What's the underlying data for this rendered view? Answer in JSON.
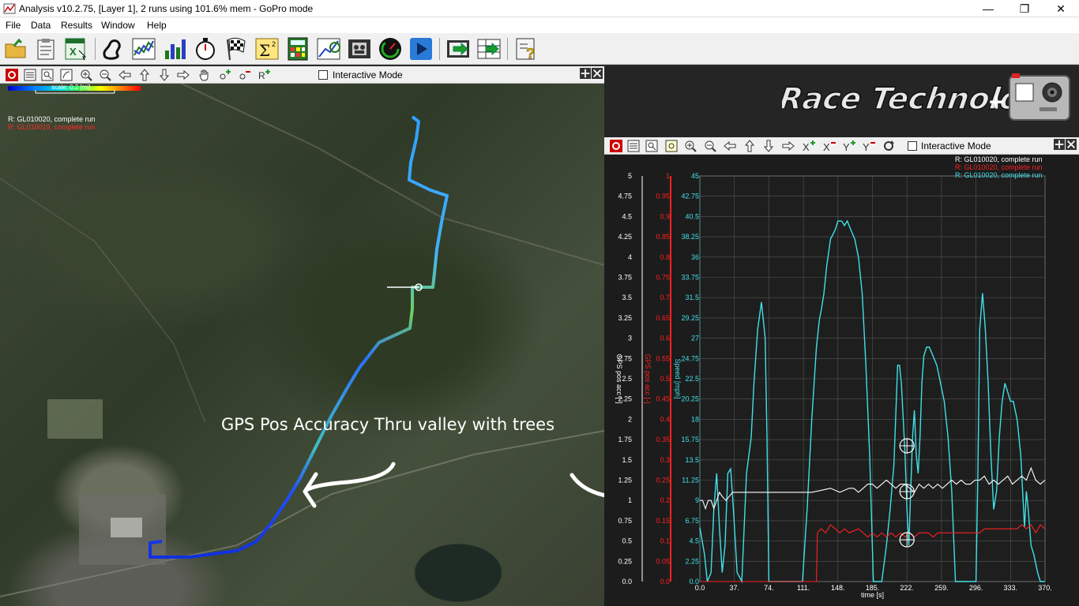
{
  "window": {
    "title": "Analysis v10.2.75, [Layer 1], 2 runs using 101.6% mem - GoPro mode",
    "controls": [
      "—",
      "❐",
      "✕"
    ]
  },
  "menu": [
    "File",
    "Data",
    "Results",
    "Window",
    "Help"
  ],
  "toolbar_icons": [
    "open-folder-icon",
    "clipboard-icon",
    "excel-icon",
    "track-map-icon",
    "line-graph-icon",
    "bar-chart-icon",
    "stopwatch-icon",
    "checkered-flag-icon",
    "sigma-icon",
    "calculator-icon",
    "xy-plot-icon",
    "video-icon",
    "gauge-icon",
    "play-icon",
    "export-video-icon",
    "export-table-icon",
    "help-icon"
  ],
  "map": {
    "interactive_mode_label": "Interactive Mode",
    "scale_label": "scale: 0.2 [mi]",
    "run_labels": [
      {
        "text": "R:  GL010020, complete run",
        "color": "#ffffff"
      },
      {
        "text": "R:  GL010019, complete run",
        "color": "#ff2a2a"
      }
    ],
    "annotation": "GPS Pos Accuracy Thru valley with trees"
  },
  "graph": {
    "interactive_mode_label": "Interactive Mode",
    "legend": [
      {
        "text": "R:  GL010020, complete run",
        "color": "#ffffff"
      },
      {
        "text": "R:  GL010020, complete run",
        "color": "#ff2020"
      },
      {
        "text": "R:  GL010020, complete run",
        "color": "#40e0e8"
      }
    ],
    "xlabel": "time [s]"
  },
  "chart_data": {
    "type": "line",
    "xlabel": "time [s]",
    "xlim": [
      0,
      370
    ],
    "x_ticks": [
      "0.0",
      "37.",
      "74.",
      "111.",
      "148.",
      "185.",
      "222.",
      "259.",
      "296.",
      "333.",
      "370."
    ],
    "axes": [
      {
        "label": "GPS pos acc [-]",
        "color": "#ffffff",
        "ylim": [
          0,
          5
        ],
        "ticks": [
          "0.0",
          "0.25",
          "0.5",
          "0.75",
          "1",
          "1.25",
          "1.5",
          "1.75",
          "2",
          "2.25",
          "2.5",
          "2.75",
          "3",
          "3.25",
          "3.5",
          "3.75",
          "4",
          "4.25",
          "4.5",
          "4.75",
          "5"
        ]
      },
      {
        "label": "GPS pos acc [-]",
        "color": "#ff2020",
        "ylim": [
          0,
          1
        ],
        "ticks": [
          "0.0",
          "0.05",
          "0.1",
          "0.15",
          "0.2",
          "0.25",
          "0.3",
          "0.35",
          "0.4",
          "0.45",
          "0.5",
          "0.55",
          "0.6",
          "0.65",
          "0.7",
          "0.75",
          "0.8",
          "0.85",
          "0.9",
          "0.95",
          "1"
        ]
      },
      {
        "label": "Speed [mph]",
        "color": "#40e0e8",
        "ylim": [
          0,
          45
        ],
        "ticks": [
          "0.0",
          "2.25",
          "4.5",
          "6.75",
          "9",
          "11.25",
          "13.5",
          "15.75",
          "18",
          "20.25",
          "22.5",
          "24.75",
          "27",
          "29.25",
          "31.5",
          "33.75",
          "36",
          "38.25",
          "40.5",
          "42.75",
          "45"
        ]
      }
    ],
    "series": [
      {
        "name": "GL010020, complete run",
        "color": "#40e0e8",
        "axis": 2,
        "x": [
          0,
          5,
          8,
          12,
          15,
          18,
          21,
          24,
          27,
          30,
          33,
          36,
          40,
          45,
          50,
          55,
          58,
          62,
          66,
          70,
          72,
          74,
          76,
          80,
          85,
          90,
          95,
          100,
          105,
          110,
          115,
          120,
          125,
          128,
          130,
          133,
          136,
          140,
          145,
          148,
          152,
          155,
          158,
          162,
          166,
          170,
          174,
          178,
          182,
          186,
          190,
          195,
          200,
          204,
          208,
          212,
          214,
          216,
          218,
          220,
          222,
          224,
          226,
          228,
          230,
          232,
          234,
          236,
          238,
          240,
          243,
          246,
          250,
          254,
          258,
          262,
          266,
          270,
          274,
          278,
          282,
          286,
          290,
          294,
          296,
          298,
          300,
          303,
          306,
          309,
          312,
          315,
          318,
          321,
          324,
          327,
          330,
          333,
          336,
          340,
          344,
          348,
          350,
          352,
          355,
          358,
          360,
          362,
          365,
          368,
          370
        ],
        "y": [
          6,
          3,
          0,
          1,
          8,
          12,
          6,
          1,
          4,
          12,
          12.5,
          8,
          1,
          0,
          12,
          16,
          22,
          28,
          31,
          27,
          16,
          0,
          0,
          0,
          0,
          0,
          0,
          0,
          0,
          0,
          8,
          18,
          26,
          29,
          30,
          32,
          35,
          38,
          39,
          40,
          40,
          39.5,
          40,
          39,
          38,
          36,
          32,
          24,
          14,
          0,
          0,
          0,
          4,
          8,
          13,
          24,
          24,
          22,
          18,
          14,
          8,
          4,
          10,
          16,
          19,
          14,
          12,
          16,
          22,
          25,
          26,
          26,
          25,
          24,
          22,
          20,
          16,
          10,
          0,
          0,
          0,
          0,
          0,
          0,
          0,
          12,
          28,
          32,
          28,
          22,
          14,
          8,
          10,
          16,
          20,
          22,
          21,
          20,
          20,
          18,
          14,
          6,
          10,
          8,
          4,
          3,
          2,
          1,
          0,
          0,
          0
        ]
      },
      {
        "name": "GL010020, complete run",
        "color": "#ffffff",
        "axis": 0,
        "x": [
          0,
          3,
          6,
          9,
          12,
          15,
          18,
          21,
          24,
          28,
          35,
          40,
          50,
          60,
          80,
          100,
          120,
          140,
          150,
          160,
          165,
          170,
          175,
          180,
          185,
          190,
          195,
          200,
          205,
          210,
          215,
          220,
          225,
          230,
          235,
          240,
          245,
          250,
          255,
          260,
          265,
          270,
          275,
          280,
          285,
          290,
          295,
          300,
          305,
          310,
          315,
          320,
          325,
          330,
          335,
          340,
          345,
          350,
          355,
          360,
          365,
          370
        ],
        "y": [
          1,
          1,
          0.9,
          1,
          1,
          0.9,
          1,
          1.1,
          1.05,
          1,
          1.1,
          1.1,
          1.1,
          1.1,
          1.1,
          1.1,
          1.1,
          1.15,
          1.1,
          1.15,
          1.15,
          1.1,
          1.15,
          1.2,
          1.2,
          1.15,
          1.2,
          1.25,
          1.2,
          1.15,
          1.2,
          1.2,
          1.15,
          1.1,
          1.2,
          1.15,
          1.2,
          1.15,
          1.2,
          1.15,
          1.2,
          1.25,
          1.2,
          1.25,
          1.2,
          1.2,
          1.25,
          1.25,
          1.3,
          1.2,
          1.25,
          1.2,
          1.25,
          1.3,
          1.2,
          1.25,
          1.3,
          1.25,
          1.4,
          1.25,
          1.2,
          1.25
        ]
      },
      {
        "name": "GL010020, complete run",
        "color": "#ff2020",
        "axis": 1,
        "x": [
          0,
          120,
          125,
          126,
          130,
          135,
          140,
          145,
          150,
          155,
          160,
          170,
          175,
          180,
          185,
          190,
          195,
          200,
          205,
          210,
          215,
          220,
          225,
          230,
          235,
          240,
          245,
          250,
          255,
          260,
          265,
          270,
          275,
          280,
          285,
          290,
          295,
          300,
          305,
          310,
          315,
          320,
          325,
          330,
          335,
          340,
          345,
          350,
          355,
          360,
          365,
          370
        ],
        "y": [
          0,
          0,
          0,
          0.12,
          0.13,
          0.12,
          0.14,
          0.13,
          0.12,
          0.13,
          0.12,
          0.13,
          0.12,
          0.11,
          0.12,
          0.11,
          0.12,
          0.11,
          0.12,
          0.11,
          0.12,
          0.11,
          0.12,
          0.11,
          0.12,
          0.12,
          0.12,
          0.11,
          0.12,
          0.12,
          0.12,
          0.12,
          0.12,
          0.12,
          0.12,
          0.12,
          0.12,
          0.12,
          0.13,
          0.13,
          0.13,
          0.13,
          0.13,
          0.13,
          0.13,
          0.13,
          0.14,
          0.13,
          0.14,
          0.12,
          0.14,
          0.13
        ]
      }
    ]
  }
}
